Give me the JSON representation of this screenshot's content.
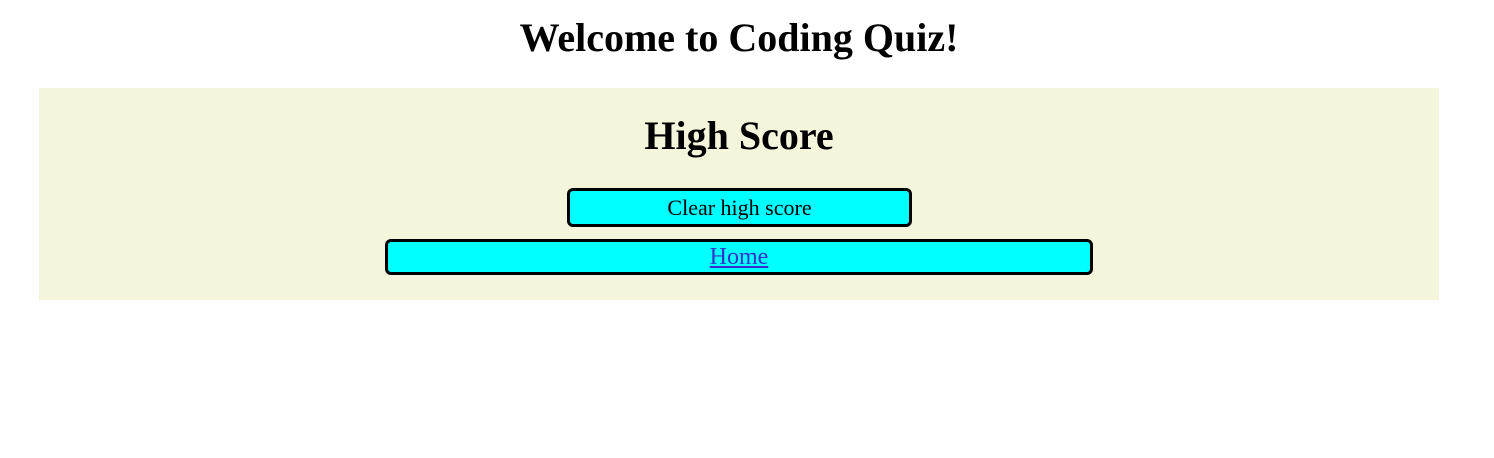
{
  "header": {
    "title": "Welcome to Coding Quiz!"
  },
  "highscore": {
    "title": "High Score",
    "clear_button_label": "Clear high score",
    "home_link_label": "Home"
  },
  "colors": {
    "panel_background": "#f5f5dc",
    "button_background": "#00ffff",
    "link_color": "#3333cc"
  }
}
